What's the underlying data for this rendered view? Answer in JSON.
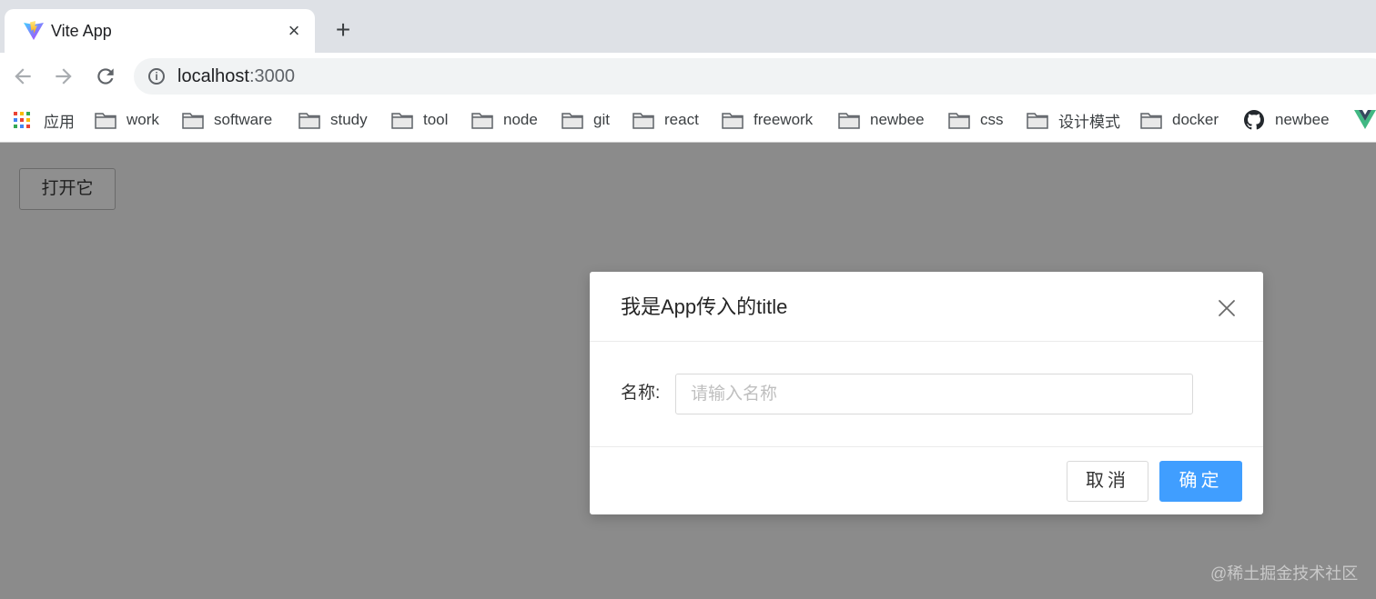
{
  "browser": {
    "tab_title": "Vite App",
    "tab_close_glyph": "×",
    "new_tab_glyph": "+",
    "url_host": "localhost",
    "url_port": ":3000",
    "bookmarks": [
      {
        "label": "应用",
        "icon": "apps-grid-icon"
      },
      {
        "label": "work",
        "icon": "folder-icon"
      },
      {
        "label": "software",
        "icon": "folder-icon"
      },
      {
        "label": "study",
        "icon": "folder-icon"
      },
      {
        "label": "tool",
        "icon": "folder-icon"
      },
      {
        "label": "node",
        "icon": "folder-icon"
      },
      {
        "label": "git",
        "icon": "folder-icon"
      },
      {
        "label": "react",
        "icon": "folder-icon"
      },
      {
        "label": "freework",
        "icon": "folder-icon"
      },
      {
        "label": "newbee",
        "icon": "folder-icon"
      },
      {
        "label": "css",
        "icon": "folder-icon"
      },
      {
        "label": "设计模式",
        "icon": "folder-icon"
      },
      {
        "label": "docker",
        "icon": "folder-icon"
      },
      {
        "label": "newbee",
        "icon": "github-icon"
      }
    ]
  },
  "page": {
    "open_button_label": "打开它",
    "watermark": "@稀土掘金技术社区"
  },
  "modal": {
    "title": "我是App传入的title",
    "field_label": "名称:",
    "input_value": "",
    "input_placeholder": "请输入名称",
    "cancel_label": "取消",
    "ok_label": "确定"
  },
  "colors": {
    "primary": "#409eff",
    "overlay_bg": "#8b8b8b"
  }
}
